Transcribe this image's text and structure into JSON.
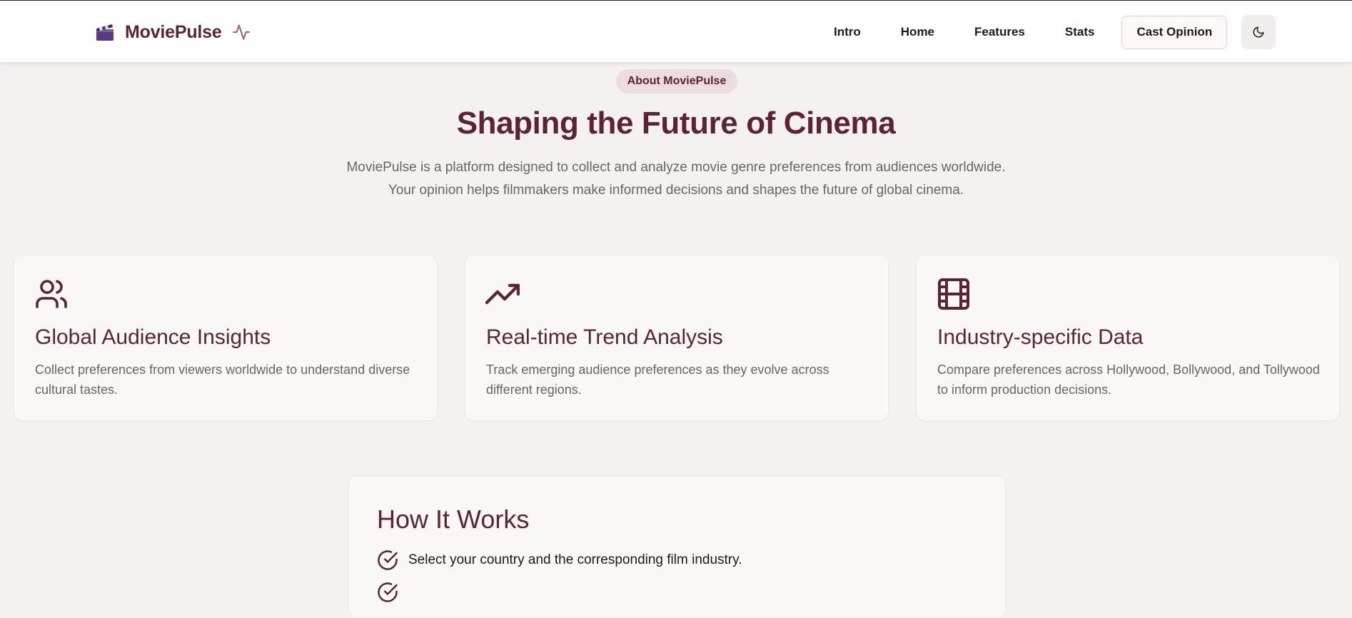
{
  "brand": {
    "name": "MoviePulse",
    "logo_icon": "clapperboard-icon",
    "pulse_icon": "activity-icon"
  },
  "nav": {
    "links": [
      {
        "label": "Intro"
      },
      {
        "label": "Home"
      },
      {
        "label": "Features"
      },
      {
        "label": "Stats"
      }
    ],
    "cta_label": "Cast Opinion",
    "theme_toggle_icon": "moon-icon"
  },
  "about": {
    "badge": "About MoviePulse",
    "title": "Shaping the Future of Cinema",
    "description": "MoviePulse is a platform designed to collect and analyze movie genre preferences from audiences worldwide. Your opinion helps filmmakers make informed decisions and shapes the future of global cinema."
  },
  "features": [
    {
      "icon": "users-icon",
      "title": "Global Audience Insights",
      "description": "Collect preferences from viewers worldwide to understand diverse cultural tastes."
    },
    {
      "icon": "trending-up-icon",
      "title": "Real-time Trend Analysis",
      "description": "Track emerging audience preferences as they evolve across different regions."
    },
    {
      "icon": "film-icon",
      "title": "Industry-specific Data",
      "description": "Compare preferences across Hollywood, Bollywood, and Tollywood to inform production decisions."
    }
  ],
  "how_it_works": {
    "title": "How It Works",
    "steps": [
      {
        "icon": "check-circle-icon",
        "text": "Select your country and the corresponding film industry."
      },
      {
        "icon": "check-circle-icon",
        "text": ""
      }
    ]
  },
  "colors": {
    "accent": "#5a2436",
    "page_background": "#f6f1f1",
    "card_background": "#faf8f7",
    "badge_background": "#ebdcdd",
    "body_text": "#6b6264"
  }
}
